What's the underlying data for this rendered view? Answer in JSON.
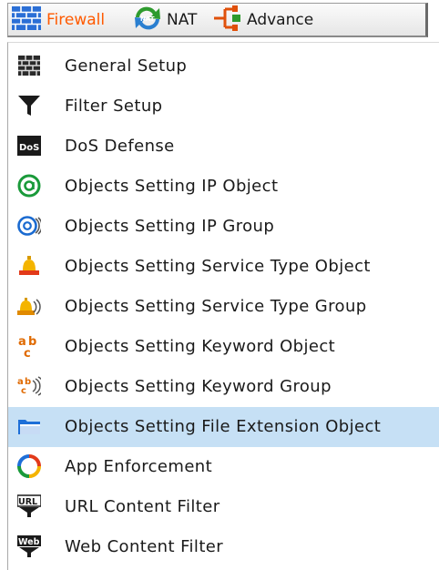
{
  "toolbar": {
    "firewall_label": "Firewall",
    "nat_label": "NAT",
    "advance_label": "Advance"
  },
  "menu": {
    "selected_index": 9,
    "items": [
      {
        "label": "General Setup",
        "icon": "wall-icon"
      },
      {
        "label": "Filter Setup",
        "icon": "funnel-icon"
      },
      {
        "label": "DoS Defense",
        "icon": "dos-icon"
      },
      {
        "label": "Objects Setting IP Object",
        "icon": "at-sign-icon"
      },
      {
        "label": "Objects Setting IP Group",
        "icon": "at-group-icon"
      },
      {
        "label": "Objects Setting Service Type Object",
        "icon": "bell-icon"
      },
      {
        "label": "Objects Setting Service Type Group",
        "icon": "bell-group-icon"
      },
      {
        "label": "Objects Setting Keyword Object",
        "icon": "abc-icon"
      },
      {
        "label": "Objects Setting Keyword Group",
        "icon": "abc-group-icon"
      },
      {
        "label": "Objects Setting File Extension Object",
        "icon": "folder-icon"
      },
      {
        "label": "App Enforcement",
        "icon": "ring-icon"
      },
      {
        "label": "URL Content Filter",
        "icon": "url-icon"
      },
      {
        "label": "Web Content Filter",
        "icon": "web-icon"
      }
    ]
  },
  "colors": {
    "firewall_text": "#ff5a00",
    "selected_row": "#c6e0f5"
  },
  "icon_badges": {
    "dos": "DoS",
    "url": "URL",
    "web": "Web",
    "nat": "NAT"
  }
}
